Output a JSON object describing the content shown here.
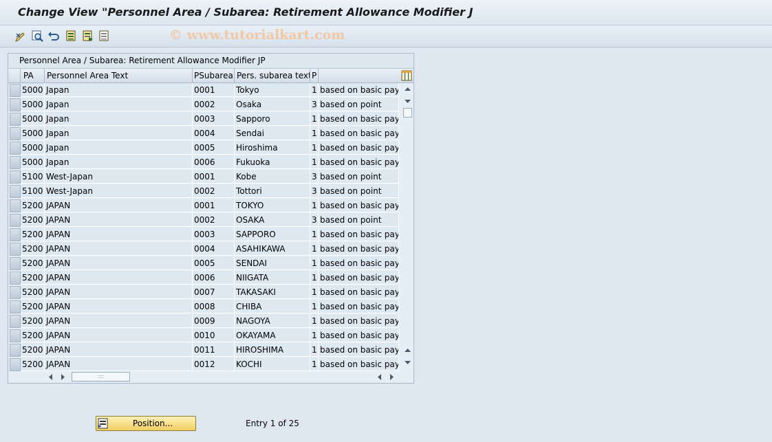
{
  "window": {
    "title": "Change View \"Personnel Area / Subarea: Retirement Allowance Modifier J"
  },
  "toolbar": {
    "watermark": "© www.tutorialkart.com",
    "icons": [
      "display-change-icon",
      "details-icon",
      "undo-icon",
      "select-all-icon",
      "select-block-icon",
      "deselect-all-icon"
    ]
  },
  "table": {
    "title": "Personnel Area / Subarea: Retirement Allowance Modifier JP",
    "columns": [
      "PA",
      "Personnel Area Text",
      "PSubarea",
      "Pers. subarea text",
      "P"
    ],
    "rows": [
      {
        "pa": "5000",
        "pa_text": "Japan",
        "psa": "0001",
        "psa_text": "Tokyo",
        "p": "1",
        "p_text": "based on basic pay"
      },
      {
        "pa": "5000",
        "pa_text": "Japan",
        "psa": "0002",
        "psa_text": "Osaka",
        "p": "3",
        "p_text": "based on point"
      },
      {
        "pa": "5000",
        "pa_text": "Japan",
        "psa": "0003",
        "psa_text": "Sapporo",
        "p": "1",
        "p_text": "based on basic pay"
      },
      {
        "pa": "5000",
        "pa_text": "Japan",
        "psa": "0004",
        "psa_text": "Sendai",
        "p": "1",
        "p_text": "based on basic pay"
      },
      {
        "pa": "5000",
        "pa_text": "Japan",
        "psa": "0005",
        "psa_text": "Hiroshima",
        "p": "1",
        "p_text": "based on basic pay"
      },
      {
        "pa": "5000",
        "pa_text": "Japan",
        "psa": "0006",
        "psa_text": "Fukuoka",
        "p": "1",
        "p_text": "based on basic pay"
      },
      {
        "pa": "5100",
        "pa_text": "West-Japan",
        "psa": "0001",
        "psa_text": "Kobe",
        "p": "3",
        "p_text": "based on point"
      },
      {
        "pa": "5100",
        "pa_text": "West-Japan",
        "psa": "0002",
        "psa_text": "Tottori",
        "p": "3",
        "p_text": "based on point"
      },
      {
        "pa": "5200",
        "pa_text": "JAPAN",
        "psa": "0001",
        "psa_text": "TOKYO",
        "p": "1",
        "p_text": "based on basic pay"
      },
      {
        "pa": "5200",
        "pa_text": "JAPAN",
        "psa": "0002",
        "psa_text": "OSAKA",
        "p": "3",
        "p_text": "based on point"
      },
      {
        "pa": "5200",
        "pa_text": "JAPAN",
        "psa": "0003",
        "psa_text": "SAPPORO",
        "p": "1",
        "p_text": "based on basic pay"
      },
      {
        "pa": "5200",
        "pa_text": "JAPAN",
        "psa": "0004",
        "psa_text": "ASAHIKAWA",
        "p": "1",
        "p_text": "based on basic pay"
      },
      {
        "pa": "5200",
        "pa_text": "JAPAN",
        "psa": "0005",
        "psa_text": "SENDAI",
        "p": "1",
        "p_text": "based on basic pay"
      },
      {
        "pa": "5200",
        "pa_text": "JAPAN",
        "psa": "0006",
        "psa_text": "NIIGATA",
        "p": "1",
        "p_text": "based on basic pay"
      },
      {
        "pa": "5200",
        "pa_text": "JAPAN",
        "psa": "0007",
        "psa_text": "TAKASAKI",
        "p": "1",
        "p_text": "based on basic pay"
      },
      {
        "pa": "5200",
        "pa_text": "JAPAN",
        "psa": "0008",
        "psa_text": "CHIBA",
        "p": "1",
        "p_text": "based on basic pay"
      },
      {
        "pa": "5200",
        "pa_text": "JAPAN",
        "psa": "0009",
        "psa_text": "NAGOYA",
        "p": "1",
        "p_text": "based on basic pay"
      },
      {
        "pa": "5200",
        "pa_text": "JAPAN",
        "psa": "0010",
        "psa_text": "OKAYAMA",
        "p": "1",
        "p_text": "based on basic pay"
      },
      {
        "pa": "5200",
        "pa_text": "JAPAN",
        "psa": "0011",
        "psa_text": "HIROSHIMA",
        "p": "1",
        "p_text": "based on basic pay"
      },
      {
        "pa": "5200",
        "pa_text": "JAPAN",
        "psa": "0012",
        "psa_text": "KOCHI",
        "p": "1",
        "p_text": "based on basic pay"
      }
    ]
  },
  "footer": {
    "position_label": "Position...",
    "entry_text": "Entry 1 of 25"
  }
}
